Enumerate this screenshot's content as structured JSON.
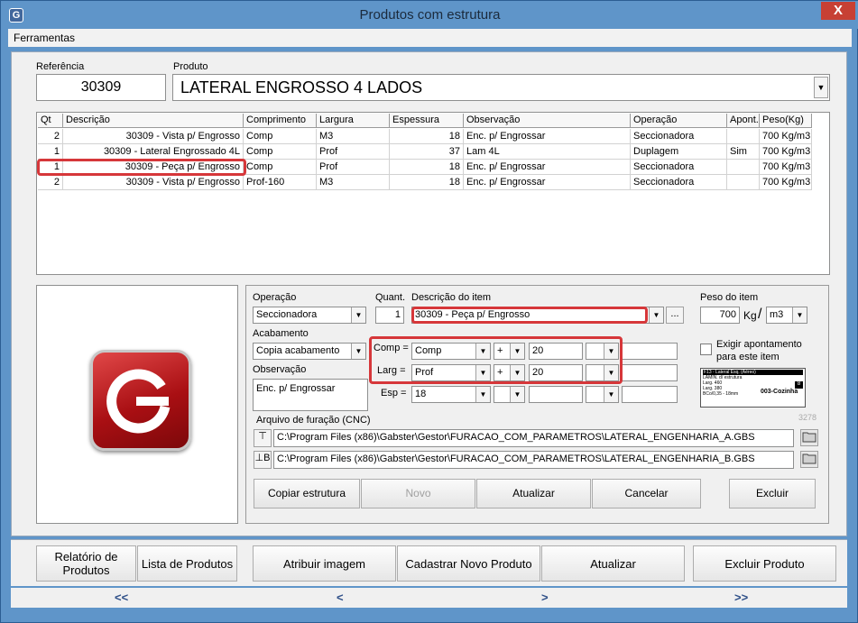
{
  "window": {
    "title": "Produtos com estrutura",
    "close_glyph": "X",
    "app_icon": "G"
  },
  "menu": {
    "items": [
      "Ferramentas"
    ]
  },
  "header": {
    "ref_label": "Referência",
    "ref_value": "30309",
    "prod_label": "Produto",
    "prod_value": "LATERAL ENGROSSO 4 LADOS"
  },
  "grid": {
    "columns": [
      "Qt",
      "Descrição",
      "Comprimento",
      "Largura",
      "Espessura",
      "Observação",
      "Operação",
      "Apont.",
      "Peso(Kg)"
    ],
    "rows": [
      [
        "2",
        "30309 -  Vista p/ Engrosso",
        "Comp",
        "M3",
        "18",
        "Enc. p/ Engrossar",
        "Seccionadora",
        "",
        "700 Kg/m3"
      ],
      [
        "1",
        "30309 - Lateral Engrossado 4L",
        "Comp",
        "Prof",
        "37",
        "Lam 4L",
        "Duplagem",
        "Sim",
        "700 Kg/m3"
      ],
      [
        "1",
        "30309 - Peça p/ Engrosso",
        "Comp",
        "Prof",
        "18",
        "Enc. p/ Engrossar",
        "Seccionadora",
        "",
        "700 Kg/m3"
      ],
      [
        "2",
        "30309 - Vista p/ Engrosso",
        "Prof-160",
        "M3",
        "18",
        "Enc. p/ Engrossar",
        "Seccionadora",
        "",
        "700 Kg/m3"
      ]
    ]
  },
  "form": {
    "operacao_label": "Operação",
    "operacao_value": "Seccionadora",
    "quant_label": "Quant.",
    "quant_value": "1",
    "descricao_label": "Descrição do item",
    "descricao_value": "30309 - Peça p/ Engrosso",
    "more_button": "...",
    "peso_label": "Peso do item",
    "peso_value": "700",
    "peso_unit": "Kg",
    "peso_slash": "/",
    "peso_vol": "m3",
    "acabamento_label": "Acabamento",
    "acabamento_value": "Copia acabamento",
    "observacao_label": "Observação",
    "observacao_value": "Enc. p/ Engrossar",
    "comp_label": "Comp =",
    "comp_base": "Comp",
    "comp_op": "+",
    "comp_val": "20",
    "larg_label": "Larg =",
    "larg_base": "Prof",
    "larg_op": "+",
    "larg_val": "20",
    "esp_label": "Esp =",
    "esp_base": "18",
    "exigir_label_1": "Exigir apontamento",
    "exigir_label_2": "para este item",
    "arquivo_label": "Arquivo de furação (CNC)",
    "counter": "3278",
    "file_a": "C:\\Program Files (x86)\\Gabster\\Gestor\\FURACAO_COM_PARAMETROS\\LATERAL_ENGENHARIA_A.GBS",
    "file_b": "C:\\Program Files (x86)\\Gabster\\Gestor\\FURACAO_COM_PARAMETROS\\LATERAL_ENGENHARIA_B.GBS",
    "btn_copiar": "Copiar estrutura",
    "btn_novo": "Novo",
    "btn_atualizar": "Atualizar",
    "btn_cancelar": "Cancelar",
    "btn_excluir": "Excluir",
    "label_preview": {
      "line1": "F13 - Lateral Esq. (Aéreo)",
      "line2": "LAMIN. d/ estrutura",
      "line3": "Larg.      460",
      "line4": "Larg.      380",
      "line5": "BCo/0,35 - 18mm",
      "footer": "003-Cozinha",
      "badge": "8"
    }
  },
  "footer": {
    "relatorio": [
      "Relatório de",
      "Produtos"
    ],
    "lista": "Lista de Produtos",
    "atribuir": "Atribuir imagem",
    "cadastrar": "Cadastrar Novo Produto",
    "atualizar": "Atualizar",
    "excluir": "Excluir Produto"
  },
  "nav": {
    "first": "<<",
    "prev": "<",
    "next": ">",
    "last": ">>"
  },
  "colors": {
    "highlight": "#d6373a",
    "titlebar": "#5f95c9",
    "logo": "#b3171b"
  }
}
